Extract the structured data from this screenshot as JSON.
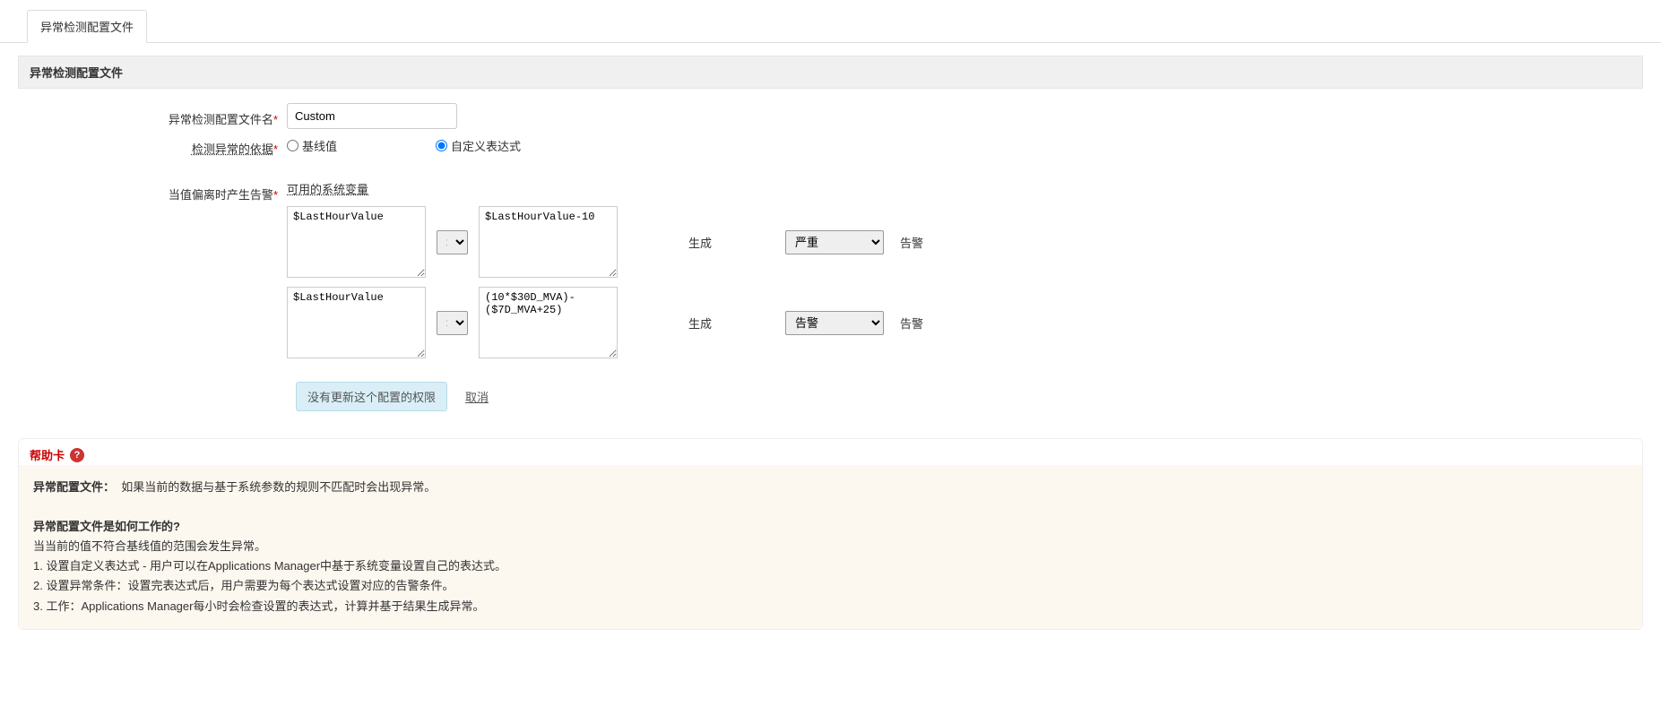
{
  "tab_label": "异常检测配置文件",
  "section_title": "异常检测配置文件",
  "labels": {
    "name": "异常检测配置文件名",
    "basis": "检测异常的依据",
    "deviation": "当值偏离时产生告警",
    "available_vars": "可用的系统变量",
    "generate": "生成",
    "alarm_suffix": "告警"
  },
  "name_value": "Custom",
  "radios": {
    "baseline": "基线值",
    "custom_expr": "自定义表达式"
  },
  "rows": [
    {
      "left": "$LastHourValue",
      "op": ">",
      "right": "$LastHourValue-10",
      "severity": "严重"
    },
    {
      "left": "$LastHourValue",
      "op": ">",
      "right": "(10*$30D_MVA)-($7D_MVA+25)",
      "severity": "告警"
    }
  ],
  "buttons": {
    "no_update": "没有更新这个配置的权限",
    "cancel": "取消"
  },
  "help": {
    "title": "帮助卡",
    "heading1": "异常配置文件：",
    "heading1_text": "如果当前的数据与基于系统参数的规则不匹配时会出现异常。",
    "heading2": "异常配置文件是如何工作的?",
    "line1": "当当前的值不符合基线值的范围会发生异常。",
    "line2": "1. 设置自定义表达式 - 用户可以在Applications Manager中基于系统变量设置自己的表达式。",
    "line3": "2. 设置异常条件：设置完表达式后，用户需要为每个表达式设置对应的告警条件。",
    "line4": "3. 工作：Applications Manager每小时会检查设置的表达式，计算并基于结果生成异常。"
  }
}
